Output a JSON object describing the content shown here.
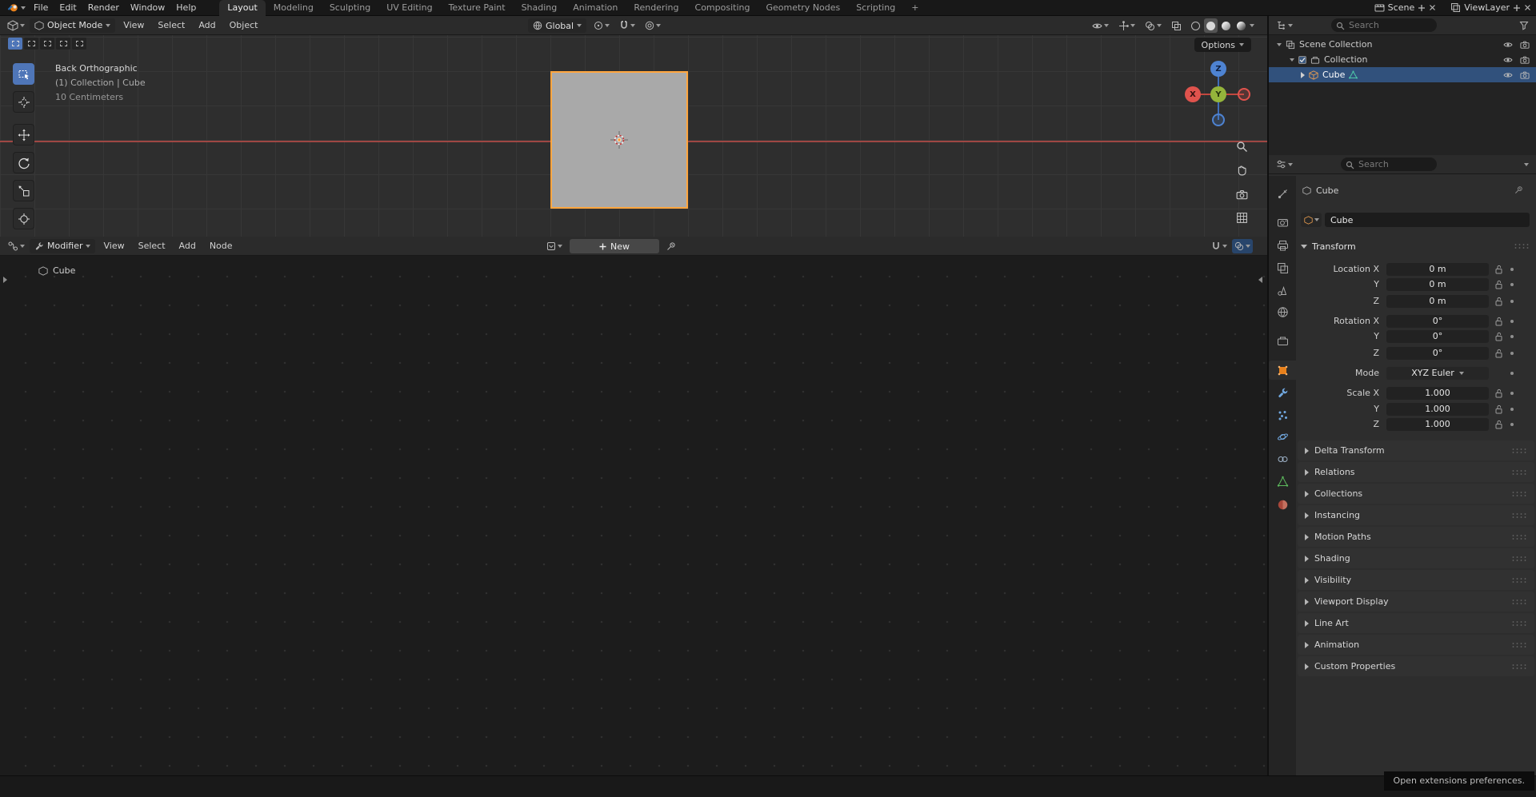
{
  "colors": {
    "accent_orange": "#e8811c",
    "active_outline_orange": "#ffa63f",
    "tool_active_blue": "#4f76b8",
    "outliner_selection_blue": "#31517c",
    "axis_x_red": "#e0534d",
    "axis_y_green": "#94b43b",
    "axis_z_blue": "#4e83d2",
    "viewport_axis_line_red": "#b24b47"
  },
  "topbar": {
    "menus": [
      "File",
      "Edit",
      "Render",
      "Window",
      "Help"
    ],
    "tabs": [
      "Layout",
      "Modeling",
      "Sculpting",
      "UV Editing",
      "Texture Paint",
      "Shading",
      "Animation",
      "Rendering",
      "Compositing",
      "Geometry Nodes",
      "Scripting"
    ],
    "add_workspace": "+",
    "scene": {
      "label": "Scene"
    },
    "view_layer": {
      "label": "ViewLayer"
    }
  },
  "viewport": {
    "header": {
      "mode": "Object Mode",
      "menus": [
        "View",
        "Select",
        "Add",
        "Object"
      ],
      "orientation": "Global"
    },
    "options_button": "Options",
    "overlay": {
      "view_label": "Back Orthographic",
      "context_label": "(1) Collection | Cube",
      "scale_label": "10 Centimeters"
    },
    "gizmo": {
      "x": "X",
      "y": "Y",
      "z": "Z"
    }
  },
  "node_editor": {
    "mode": "Modifier",
    "menus": [
      "View",
      "Select",
      "Add",
      "Node"
    ],
    "new_button": "New",
    "breadcrumb": "Cube"
  },
  "outliner": {
    "search_placeholder": "Search",
    "rows": [
      {
        "label": "Scene Collection"
      },
      {
        "label": "Collection"
      },
      {
        "label": "Cube"
      }
    ]
  },
  "properties": {
    "search_placeholder": "Search",
    "breadcrumb": "Cube",
    "name_field": "Cube",
    "transform": {
      "title": "Transform",
      "rows": [
        {
          "label": "Location X",
          "value": "0 m"
        },
        {
          "label": "Y",
          "value": "0 m"
        },
        {
          "label": "Z",
          "value": "0 m"
        },
        {
          "label": "Rotation X",
          "value": "0°"
        },
        {
          "label": "Y",
          "value": "0°"
        },
        {
          "label": "Z",
          "value": "0°"
        },
        {
          "label": "Mode",
          "value": "XYZ Euler"
        },
        {
          "label": "Scale X",
          "value": "1.000"
        },
        {
          "label": "Y",
          "value": "1.000"
        },
        {
          "label": "Z",
          "value": "1.000"
        }
      ]
    },
    "panels": [
      "Delta Transform",
      "Relations",
      "Collections",
      "Instancing",
      "Motion Paths",
      "Shading",
      "Visibility",
      "Viewport Display",
      "Line Art",
      "Animation",
      "Custom Properties"
    ]
  },
  "status_bar": {
    "message": "Open extensions preferences."
  }
}
